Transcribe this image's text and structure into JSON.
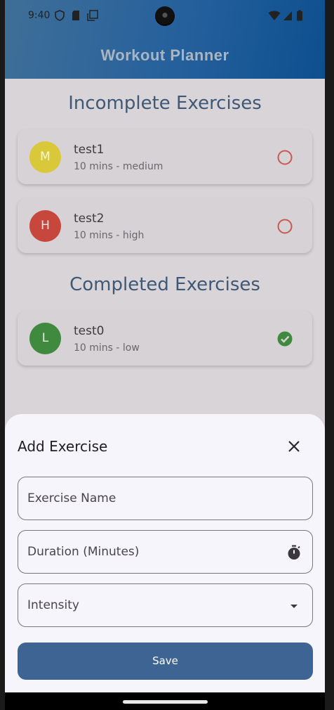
{
  "status_bar": {
    "time": "9:40"
  },
  "app_bar": {
    "title": "Workout Planner"
  },
  "sections": {
    "incomplete_title": "Incomplete Exercises",
    "completed_title": "Completed Exercises"
  },
  "incomplete": [
    {
      "initial": "M",
      "name": "test1",
      "detail": "10 mins - medium",
      "color": "#d9c83a"
    },
    {
      "initial": "H",
      "name": "test2",
      "detail": "10 mins - high",
      "color": "#c8473d"
    }
  ],
  "completed": [
    {
      "initial": "L",
      "name": "test0",
      "detail": "10 mins - low",
      "color": "#3f8a3e"
    }
  ],
  "colors": {
    "incomplete_ring": "#c65a52",
    "complete_check": "#3f8a3e",
    "primary": "#3d6493"
  },
  "sheet": {
    "title": "Add Exercise",
    "fields": {
      "name_label": "Exercise Name",
      "duration_label": "Duration (Minutes)",
      "intensity_label": "Intensity"
    },
    "save_label": "Save",
    "icons": {
      "close": "close-icon",
      "duration": "timer-icon",
      "intensity": "dropdown-arrow-icon"
    }
  }
}
